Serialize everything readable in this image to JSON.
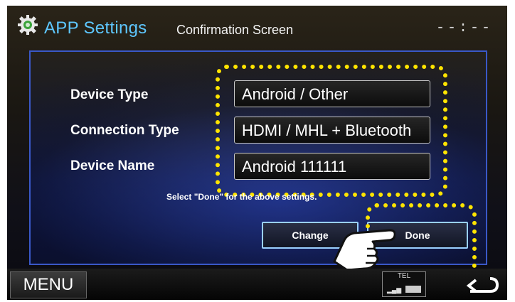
{
  "header": {
    "app_title": "APP Settings",
    "subtitle": "Confirmation Screen",
    "clock": "--:--",
    "icon": "gear-icon"
  },
  "settings": [
    {
      "label": "Device Type",
      "value": "Android / Other"
    },
    {
      "label": "Connection Type",
      "value": "HDMI / MHL + Bluetooth"
    },
    {
      "label": "Device Name",
      "value": "Android 111111"
    }
  ],
  "hint": "Select \"Done\" for the above settings.",
  "buttons": {
    "change": "Change",
    "done": "Done"
  },
  "bottom_bar": {
    "menu": "MENU",
    "tel": "TEL",
    "back_icon": "back-arrow-icon"
  },
  "colors": {
    "accent": "#5ec7ff",
    "highlight": "#ffe400",
    "panel_border": "#3a58c8"
  }
}
